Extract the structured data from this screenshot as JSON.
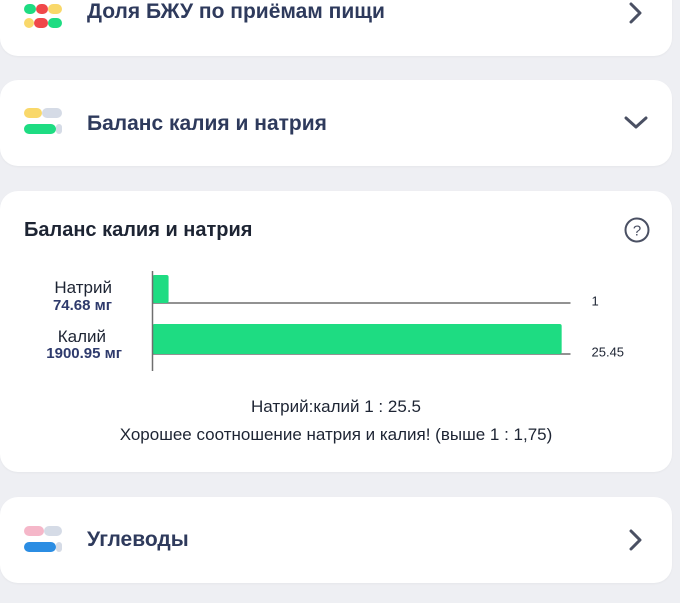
{
  "rows": {
    "macros": {
      "title": "Доля БЖУ по приёмам пищи"
    },
    "potassium_sodium": {
      "title": "Баланс калия и натрия"
    },
    "carbs": {
      "title": "Углеводы"
    }
  },
  "detail": {
    "title": "Баланс калия и натрия",
    "sodium": {
      "label": "Натрий",
      "amount": "74.68 мг"
    },
    "potassium": {
      "label": "Калий",
      "amount": "1900.95 мг"
    },
    "ratio_text": "Натрий:калий 1 : 25.5",
    "verdict_text": "Хорошее соотношение натрия и калия! (выше 1 : 1,75)"
  },
  "chart_data": {
    "type": "bar",
    "orientation": "horizontal",
    "categories": [
      "Натрий",
      "Калий"
    ],
    "values": [
      1,
      25.45
    ],
    "data_labels": [
      "1",
      "25.45"
    ],
    "bar_color": "#1edc82",
    "xlim": [
      0,
      26
    ]
  },
  "colors": {
    "green": "#1edc82",
    "red": "#f0484a",
    "yellow": "#f9d86a",
    "pink": "#f5b7c9",
    "blue": "#2b8de3",
    "title_text": "#2e3a5c"
  },
  "icons": {
    "macros": "color-bars-icon",
    "potassium_sodium": "color-bars-icon",
    "carbs": "color-bars-icon",
    "chevron_right": "chevron-right-icon",
    "chevron_down": "chevron-down-icon",
    "help": "question-circle-icon"
  }
}
